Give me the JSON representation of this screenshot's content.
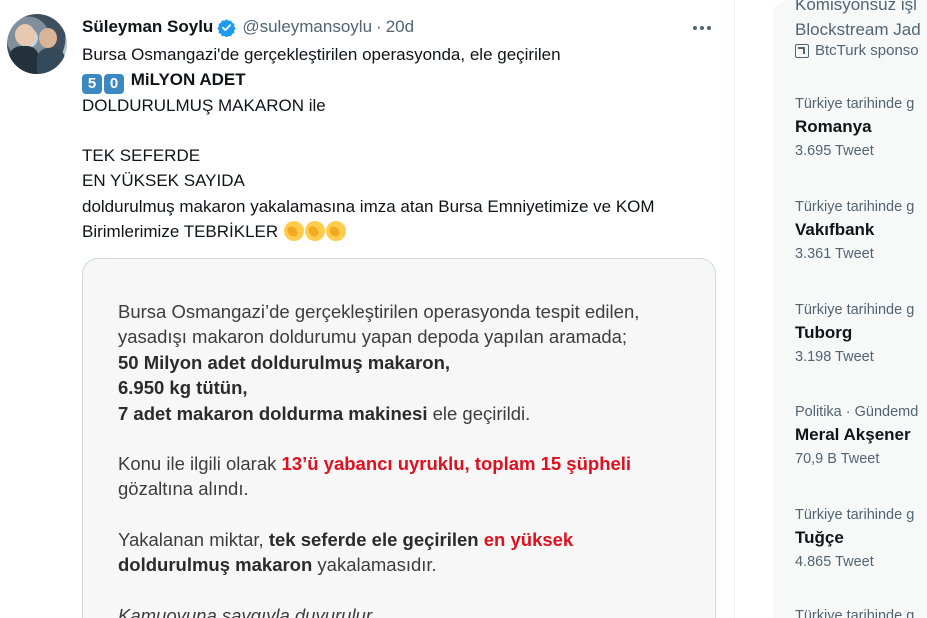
{
  "tweet": {
    "author_name": "Süleyman Soylu",
    "handle": "@suleymansoylu",
    "separator": "·",
    "time": "20d",
    "keycap_1": "5",
    "keycap_2": "0",
    "lines": {
      "l1": "Bursa Osmangazi'de gerçekleştirilen operasyonda, ele geçirilen",
      "l2": "MiLYON ADET",
      "l3": "DOLDURULMUŞ MAKARON ile",
      "l5": "TEK SEFERDE",
      "l6": "EN YÜKSEK SAYIDA",
      "l7": "doldurulmuş makaron yakalamasına imza atan Bursa Emniyetimize ve KOM",
      "l8": "Birimlerimize TEBRİKLER"
    },
    "emoji": "clapping-hands x3"
  },
  "card": {
    "l1": "Bursa Osmangazi’de gerçekleştirilen operasyonda tespit edilen,",
    "l2": "yasadışı makaron doldurumu yapan depoda yapılan aramada;",
    "l3": "50 Milyon adet doldurulmuş makaron,",
    "l4": "6.950 kg tütün,",
    "l5a": "7 adet makaron doldurma makinesi",
    "l5b": " ele geçirildi.",
    "l6a": "Konu ile ilgili olarak ",
    "l6b": "13’ü yabancı uyruklu, toplam 15 şüpheli",
    "l7": "gözaltına alındı.",
    "l8a": "Yakalanan miktar, ",
    "l8b": "tek seferde ele geçirilen ",
    "l8c": "en yüksek",
    "l9a": "doldurulmuş makaron",
    "l9b": " yakalamasıdır.",
    "l10": "Kamuoyuna saygıyla duyurulur"
  },
  "sidebar": {
    "promo_line1": "Komisyonsuz işl",
    "promo_line2": "Blockstream Jad",
    "sponsor": "BtcTurk sponso",
    "trends": [
      {
        "context": "Türkiye tarihinde g",
        "title": "Romanya",
        "count": "3.695 Tweet"
      },
      {
        "context": "Türkiye tarihinde g",
        "title": "Vakıfbank",
        "count": "3.361 Tweet"
      },
      {
        "context": "Türkiye tarihinde g",
        "title": "Tuborg",
        "count": "3.198 Tweet"
      },
      {
        "context": "Politika · Gündemd",
        "title": "Meral Akşener",
        "count": "70,9 B Tweet"
      },
      {
        "context": "Türkiye tarihinde g",
        "title": "Tuğçe",
        "count": "4.865 Tweet"
      },
      {
        "context": "Türkiye tarihinde g",
        "title": "",
        "count": ""
      }
    ]
  },
  "colors": {
    "verified": "#1d9bf0",
    "keycap": "#3b88c3",
    "highlight_red": "#e0101e",
    "secondary_text": "#536471"
  }
}
